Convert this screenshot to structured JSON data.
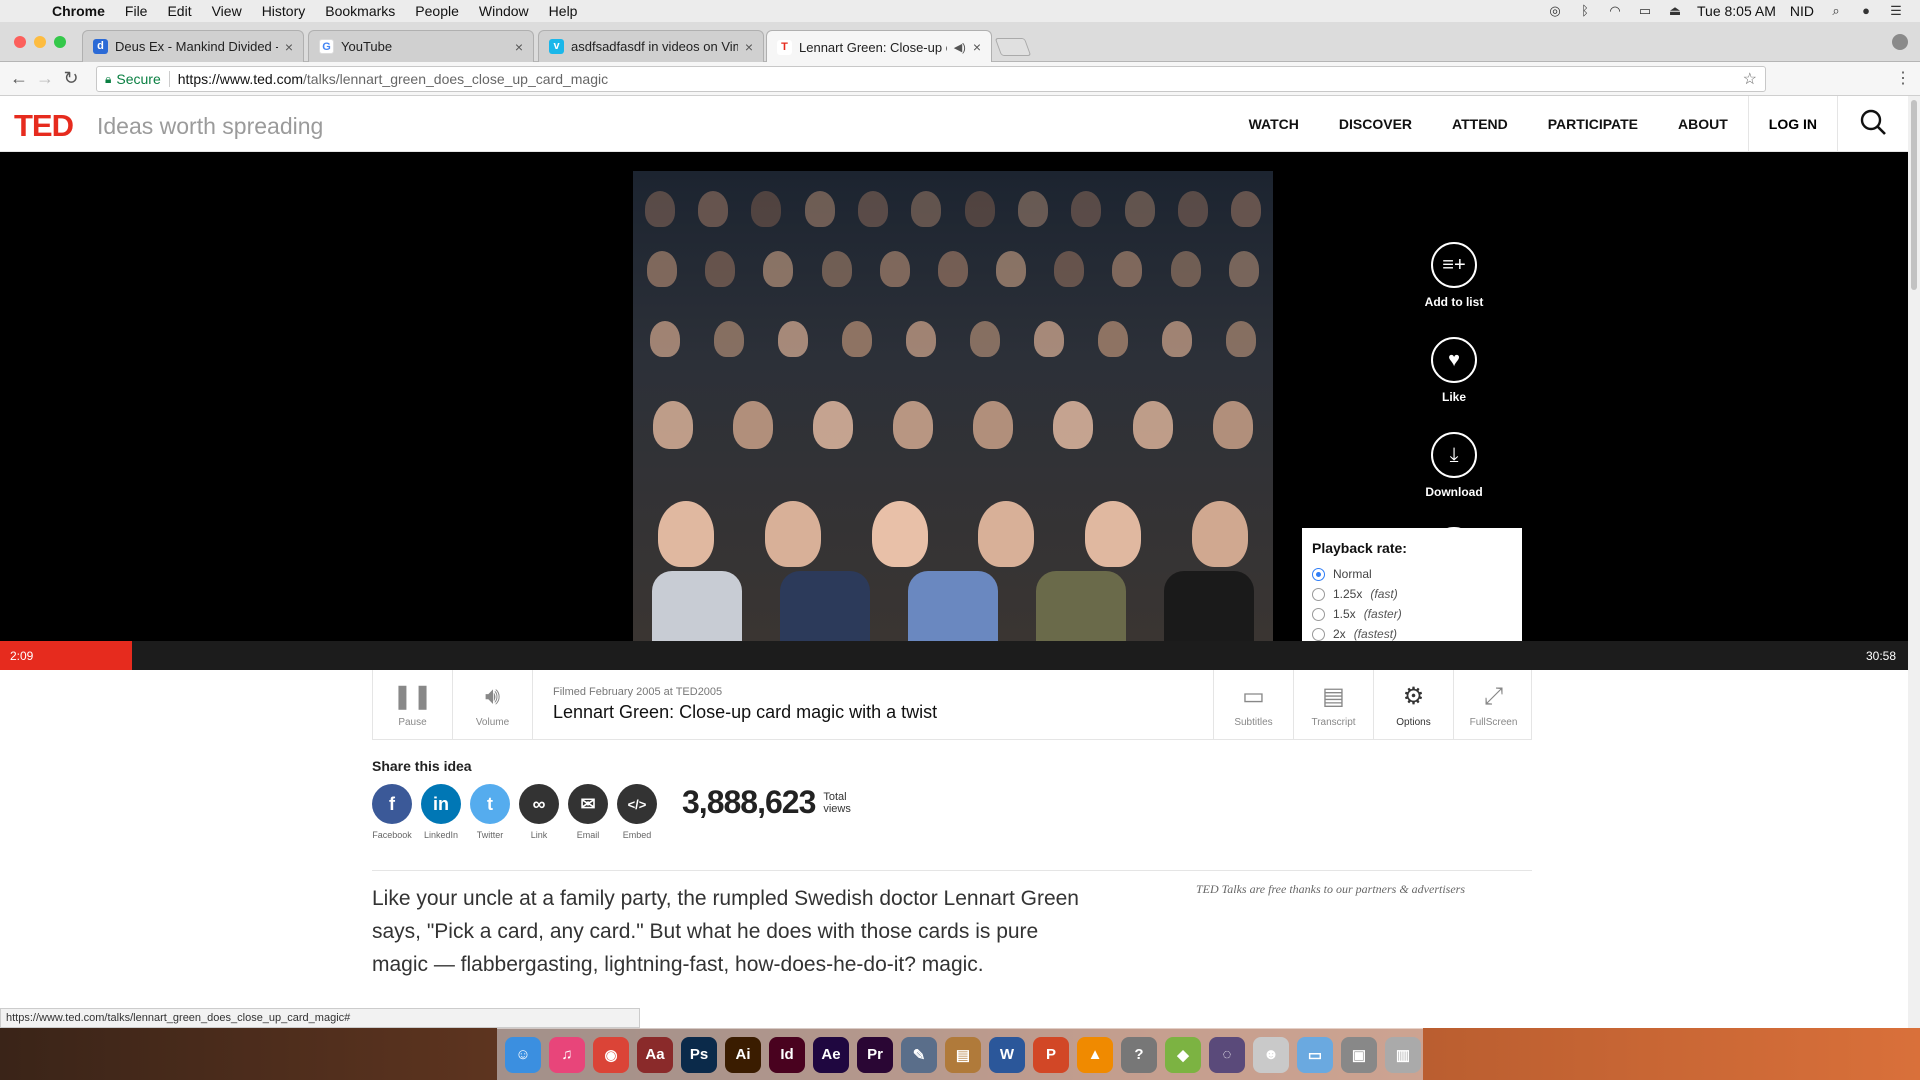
{
  "menubar": {
    "app": "Chrome",
    "items": [
      "File",
      "Edit",
      "View",
      "History",
      "Bookmarks",
      "People",
      "Window",
      "Help"
    ],
    "clock": "Tue 8:05 AM",
    "user": "NID"
  },
  "tabs": [
    {
      "title": "Deus Ex - Mankind Divided - C",
      "favicon": "d",
      "favicon_color": "#2b6ad6"
    },
    {
      "title": "YouTube",
      "favicon": "G",
      "favicon_color": "#ffffff"
    },
    {
      "title": "asdfsadfasdf in videos on Vim",
      "favicon": "v",
      "favicon_color": "#1ab7ea"
    },
    {
      "title": "Lennart Green: Close-up ca",
      "favicon": "T",
      "favicon_color": "#e62b1e"
    }
  ],
  "address": {
    "secure_label": "Secure",
    "url_host": "https://www.ted.com",
    "url_path": "/talks/lennart_green_does_close_up_card_magic"
  },
  "ted": {
    "logo": "TED",
    "tagline": "Ideas worth spreading",
    "nav": [
      "WATCH",
      "DISCOVER",
      "ATTEND",
      "PARTICIPATE",
      "ABOUT"
    ],
    "login": "LOG IN"
  },
  "side_actions": [
    {
      "label": "Add to list",
      "icon": "add-to-list-icon",
      "glyph": "≡+"
    },
    {
      "label": "Like",
      "icon": "heart-icon",
      "glyph": "♥"
    },
    {
      "label": "Download",
      "icon": "download-icon",
      "glyph": "⤓"
    }
  ],
  "playback": {
    "title": "Playback rate:",
    "options": [
      {
        "label": "Normal",
        "note": "",
        "selected": true
      },
      {
        "label": "1.25x",
        "note": "(fast)",
        "selected": false
      },
      {
        "label": "1.5x",
        "note": "(faster)",
        "selected": false
      },
      {
        "label": "2x",
        "note": "(fastest)",
        "selected": false
      }
    ]
  },
  "progress": {
    "current": "2:09",
    "duration": "30:58",
    "fraction": 0.0694
  },
  "controls": {
    "pause": "Pause",
    "volume": "Volume",
    "filmed": "Filmed February 2005 at TED2005",
    "talk_title": "Lennart Green: Close-up card magic with a twist",
    "subtitles": "Subtitles",
    "transcript": "Transcript",
    "options": "Options",
    "fullscreen": "FullScreen"
  },
  "share": {
    "heading": "Share this idea",
    "items": [
      {
        "label": "Facebook",
        "glyph": "f",
        "color": "#3b5998"
      },
      {
        "label": "LinkedIn",
        "glyph": "in",
        "color": "#0077b5"
      },
      {
        "label": "Twitter",
        "glyph": "t",
        "color": "#55acee"
      },
      {
        "label": "Link",
        "glyph": "∞",
        "color": "#333333"
      },
      {
        "label": "Email",
        "glyph": "✉",
        "color": "#333333"
      },
      {
        "label": "Embed",
        "glyph": "</>",
        "color": "#333333"
      }
    ],
    "views": "3,888,623",
    "views_label_1": "Total",
    "views_label_2": "views"
  },
  "description": "Like your uncle at a family party, the rumpled Swedish doctor Lennart Green says, \"Pick a card, any card.\" But what he does with those cards is pure magic — flabbergasting, lightning-fast, how-does-he-do-it? magic.",
  "partners_note": "TED Talks are free thanks to our partners & advertisers",
  "status_url": "https://www.ted.com/talks/lennart_green_does_close_up_card_magic#",
  "dock": [
    {
      "name": "finder",
      "glyph": "☺",
      "color": "#3b8fe0"
    },
    {
      "name": "itunes",
      "glyph": "♫",
      "color": "#e8457a"
    },
    {
      "name": "chrome",
      "glyph": "◉",
      "color": "#db4437"
    },
    {
      "name": "dictionary",
      "glyph": "Aa",
      "color": "#8a2a2a"
    },
    {
      "name": "photoshop",
      "glyph": "Ps",
      "color": "#0b2a4a"
    },
    {
      "name": "illustrator",
      "glyph": "Ai",
      "color": "#3a1c00"
    },
    {
      "name": "indesign",
      "glyph": "Id",
      "color": "#49021f"
    },
    {
      "name": "after-effects",
      "glyph": "Ae",
      "color": "#1f0740"
    },
    {
      "name": "premiere",
      "glyph": "Pr",
      "color": "#2a0634"
    },
    {
      "name": "instruments",
      "glyph": "✎",
      "color": "#5a6e8a"
    },
    {
      "name": "preview",
      "glyph": "▤",
      "color": "#b07a3a"
    },
    {
      "name": "word",
      "glyph": "W",
      "color": "#2b579a"
    },
    {
      "name": "powerpoint",
      "glyph": "P",
      "color": "#d24726"
    },
    {
      "name": "vlc",
      "glyph": "▲",
      "color": "#f08a00"
    },
    {
      "name": "help",
      "glyph": "?",
      "color": "#777777"
    },
    {
      "name": "android-file-transfer",
      "glyph": "◆",
      "color": "#7cb342"
    },
    {
      "name": "scrobbles",
      "glyph": "◌",
      "color": "#5a4a7a"
    },
    {
      "name": "emoji",
      "glyph": "☻",
      "color": "#c9c9c9"
    },
    {
      "name": "downloads-folder",
      "glyph": "▭",
      "color": "#6aa9e0"
    },
    {
      "name": "screen-capture",
      "glyph": "▣",
      "color": "#888888"
    },
    {
      "name": "trash",
      "glyph": "▥",
      "color": "#aaaaaa"
    }
  ]
}
